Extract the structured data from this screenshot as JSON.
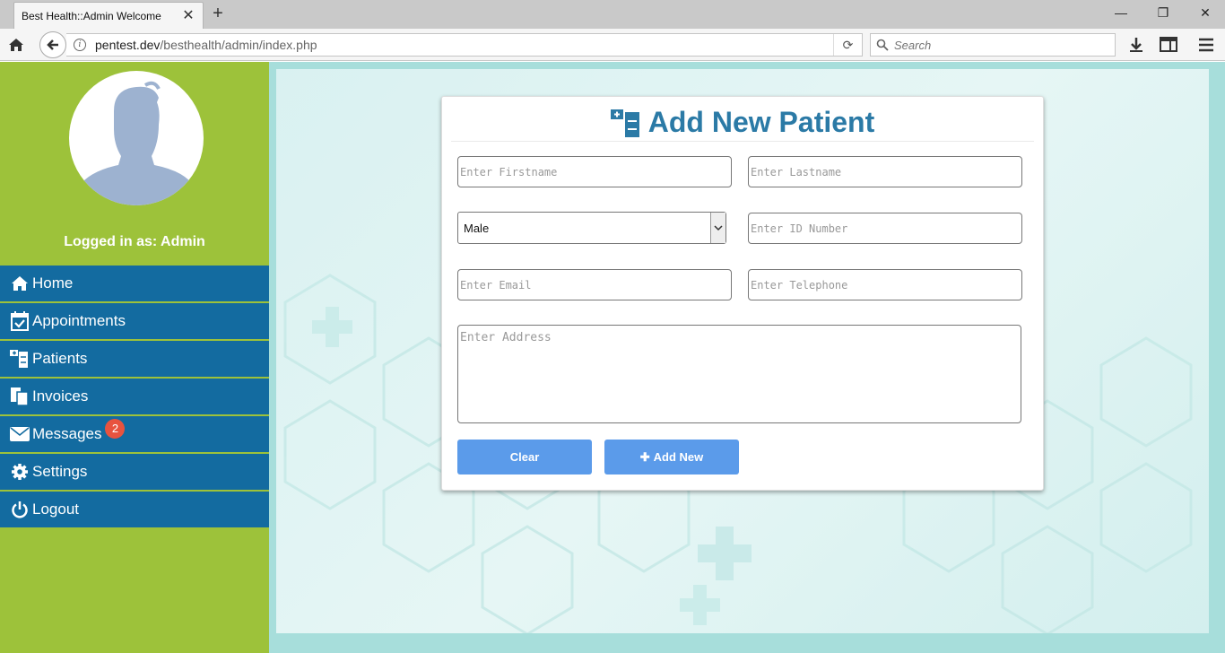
{
  "browser": {
    "tab_title": "Best Health::Admin Welcome",
    "url_host": "pentest.dev",
    "url_path": "/besthealth/admin/index.php",
    "search_placeholder": "Search"
  },
  "sidebar": {
    "logged_in_text": "Logged in as: Admin",
    "items": [
      {
        "label": "Home",
        "icon": "home-icon"
      },
      {
        "label": "Appointments",
        "icon": "calendar-check-icon"
      },
      {
        "label": "Patients",
        "icon": "patients-icon"
      },
      {
        "label": "Invoices",
        "icon": "invoices-icon"
      },
      {
        "label": "Messages",
        "icon": "envelope-icon",
        "badge": "2"
      },
      {
        "label": "Settings",
        "icon": "gear-icon"
      },
      {
        "label": "Logout",
        "icon": "power-icon"
      }
    ]
  },
  "form": {
    "title": "Add New Patient",
    "firstname_placeholder": "Enter Firstname",
    "lastname_placeholder": "Enter Lastname",
    "gender_selected": "Male",
    "id_placeholder": "Enter ID Number",
    "email_placeholder": "Enter Email",
    "telephone_placeholder": "Enter Telephone",
    "address_placeholder": "Enter Address",
    "clear_label": "Clear",
    "add_label": "Add New"
  },
  "colors": {
    "sidebar_bg": "#9dc23a",
    "menu_bg": "#136ba0",
    "title_color": "#2b7aa6",
    "button_bg": "#5b9bea",
    "badge_bg": "#e8533f"
  }
}
